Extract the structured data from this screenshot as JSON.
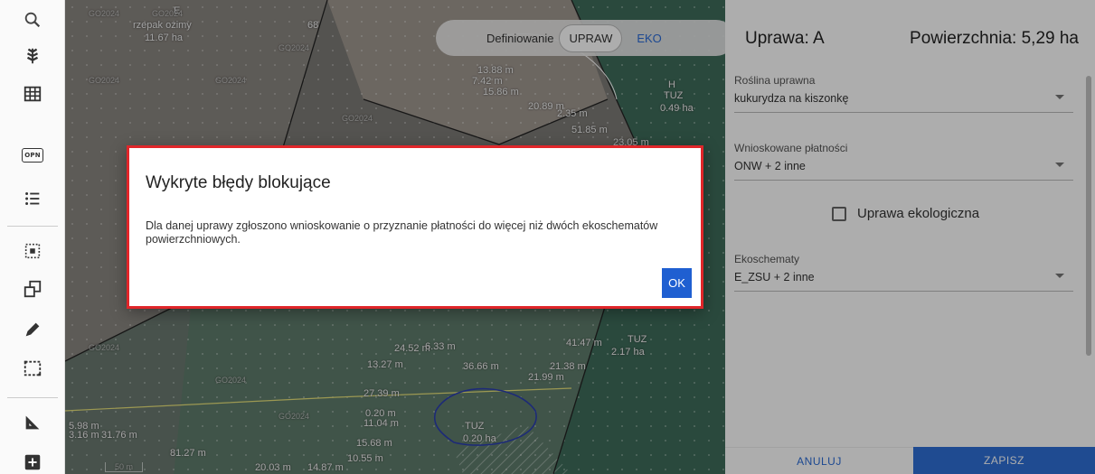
{
  "mode_bar": {
    "label": "Definiowanie",
    "options": [
      "UPRAW",
      "EKO"
    ],
    "active": "UPRAW"
  },
  "map": {
    "labels": [
      "rzepak ozimy",
      "11.67 ha",
      "E",
      "68",
      "13.88 m",
      "7.42 m",
      "15.86 m",
      "20.89 m",
      "2.35 m",
      "51.85 m",
      "23.05 m",
      "H",
      "TUZ",
      "0.49 ha",
      "24.52 m",
      "6.33 m",
      "13.27 m",
      "36.66 m",
      "21.38 m",
      "21.99 m",
      "41.47 m",
      "TUZ",
      "2.17 ha",
      "27.39 m",
      "0.20 m",
      "11.04 m",
      "15.68 m",
      "TUZ",
      "0.20 ha",
      "10.55 m",
      "14.87 m",
      "81.27 m",
      "20.03 m",
      "5.98 m",
      "3.16 m",
      "31.76 m",
      "50 m"
    ],
    "watermark": "GO2024"
  },
  "panel": {
    "crop_title": "Uprawa: A",
    "area": "Powierzchnia: 5,29 ha",
    "crop_plant": {
      "label": "Roślina uprawna",
      "value": "kukurydza na kiszonkę"
    },
    "payments": {
      "label": "Wnioskowane płatności",
      "value": "ONW + 2 inne"
    },
    "eco_checkbox": {
      "label": "Uprawa ekologiczna",
      "checked": false
    },
    "ecoschemes": {
      "label": "Ekoschematy",
      "value": "E_ZSU + 2 inne"
    },
    "cancel_label": "ANULUJ",
    "save_label": "ZAPISZ"
  },
  "dialog": {
    "title": "Wykryte błędy blokujące",
    "message": "Dla danej uprawy zgłoszono wnioskowanie o przyznanie płatności do więcej niż dwóch ekoschematów powierzchniowych.",
    "ok_label": "OK"
  },
  "toolbar_icons": [
    "search-icon",
    "crop-icon",
    "grid-icon",
    "opn-icon",
    "list-icon",
    "select-area-icon",
    "copy-shape-icon",
    "pencil-icon",
    "dashed-rect-icon",
    "measure-angle-icon",
    "add-icon"
  ],
  "toolbar_opn_text": "OPN",
  "colors": {
    "accent": "#2f6fd6",
    "error_border": "#e0262a",
    "map_green": "#3e6c5a"
  }
}
